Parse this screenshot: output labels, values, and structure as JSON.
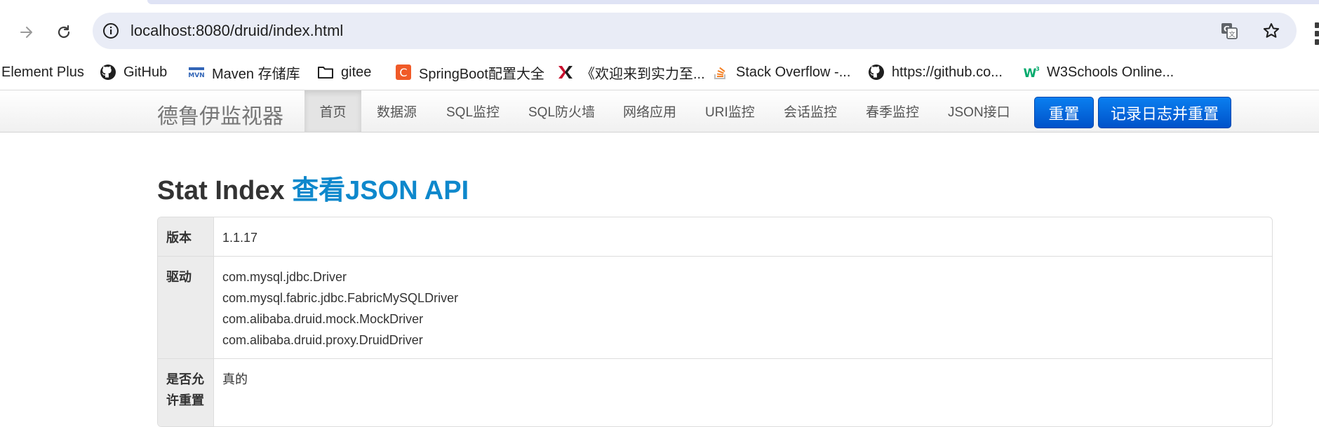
{
  "browser": {
    "url": "localhost:8080/druid/index.html",
    "bookmarks": [
      {
        "label": "Element Plus",
        "icon": "none"
      },
      {
        "label": "GitHub",
        "icon": "github-icon"
      },
      {
        "label": "Maven 存储库",
        "icon": "maven-icon"
      },
      {
        "label": "gitee",
        "icon": "folder-icon"
      },
      {
        "label": "SpringBoot配置大全",
        "icon": "c-logo-icon"
      },
      {
        "label": "《欢迎来到实力至...",
        "icon": "red-logo-icon"
      },
      {
        "label": "Stack Overflow -...",
        "icon": "stackoverflow-icon"
      },
      {
        "label": "https://github.co...",
        "icon": "github-icon"
      },
      {
        "label": "W3Schools Online...",
        "icon": "w3schools-icon"
      }
    ]
  },
  "navbar": {
    "brand": "德鲁伊监视器",
    "items": [
      "首页",
      "数据源",
      "SQL监控",
      "SQL防火墙",
      "网络应用",
      "URI监控",
      "会话监控",
      "春季监控",
      "JSON接口"
    ],
    "active_index": 0,
    "reset_label": "重置",
    "log_reset_label": "记录日志并重置"
  },
  "page": {
    "title": "Stat Index",
    "title_link": "查看JSON API"
  },
  "stats": [
    {
      "label": "版本",
      "values": [
        "1.1.17"
      ]
    },
    {
      "label": "驱动",
      "values": [
        "com.mysql.jdbc.Driver",
        "com.mysql.fabric.jdbc.FabricMySQLDriver",
        "com.alibaba.druid.mock.MockDriver",
        "com.alibaba.druid.proxy.DruidDriver"
      ]
    },
    {
      "label": "是否允许重置",
      "values": [
        "真的"
      ]
    }
  ],
  "colors": {
    "primary_button": "#0a6ee0",
    "title_link": "#0e88cc",
    "omnibox_bg": "#e9ecf6"
  }
}
